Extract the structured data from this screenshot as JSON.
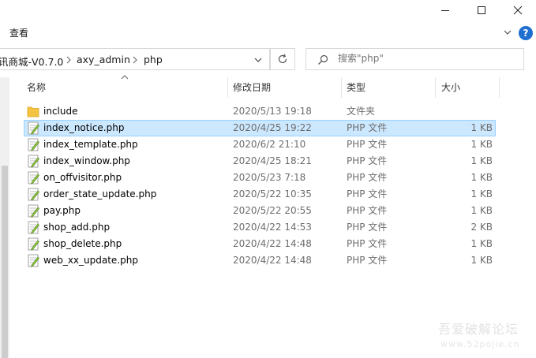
{
  "window": {
    "minimize_glyph": "minimize-icon",
    "maximize_glyph": "maximize-icon",
    "close_glyph": "close-icon"
  },
  "menu": {
    "view_label": "查看",
    "help_label": "?"
  },
  "address": {
    "crumbs": [
      "讯商城-V0.7.0",
      "axy_admin",
      "php"
    ]
  },
  "search": {
    "placeholder": "搜索\"php\""
  },
  "columns": {
    "name": "名称",
    "modified": "修改日期",
    "type": "类型",
    "size": "大小"
  },
  "files": [
    {
      "name": "include",
      "modified": "2020/5/13 19:18",
      "type": "文件夹",
      "size": "",
      "kind": "folder"
    },
    {
      "name": "index_notice.php",
      "modified": "2020/4/25 19:22",
      "type": "PHP 文件",
      "size": "1 KB",
      "kind": "php",
      "selected": true
    },
    {
      "name": "index_template.php",
      "modified": "2020/6/2 21:10",
      "type": "PHP 文件",
      "size": "1 KB",
      "kind": "php"
    },
    {
      "name": "index_window.php",
      "modified": "2020/4/25 18:21",
      "type": "PHP 文件",
      "size": "1 KB",
      "kind": "php"
    },
    {
      "name": "on_offvisitor.php",
      "modified": "2020/5/23 7:18",
      "type": "PHP 文件",
      "size": "1 KB",
      "kind": "php"
    },
    {
      "name": "order_state_update.php",
      "modified": "2020/5/22 10:35",
      "type": "PHP 文件",
      "size": "1 KB",
      "kind": "php"
    },
    {
      "name": "pay.php",
      "modified": "2020/5/22 20:55",
      "type": "PHP 文件",
      "size": "1 KB",
      "kind": "php"
    },
    {
      "name": "shop_add.php",
      "modified": "2020/4/22 14:53",
      "type": "PHP 文件",
      "size": "2 KB",
      "kind": "php"
    },
    {
      "name": "shop_delete.php",
      "modified": "2020/4/22 14:48",
      "type": "PHP 文件",
      "size": "1 KB",
      "kind": "php"
    },
    {
      "name": "web_xx_update.php",
      "modified": "2020/4/22 14:48",
      "type": "PHP 文件",
      "size": "1 KB",
      "kind": "php"
    }
  ],
  "watermark": {
    "line1": "吾爱破解论坛",
    "line2": "www.52pojie.cn"
  },
  "colors": {
    "selected_bg": "#cce8ff",
    "selected_border": "#99d1ff",
    "folder": "#f5c342",
    "help_icon": "#1f6fd0"
  }
}
